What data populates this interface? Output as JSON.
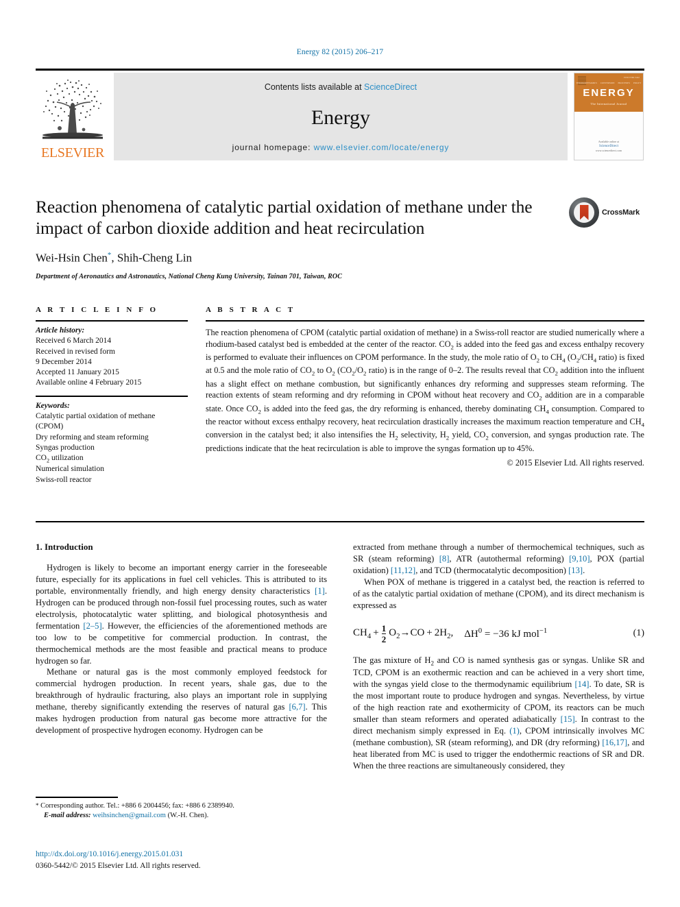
{
  "running_head": "Energy 82 (2015) 206–217",
  "masthead": {
    "publisher_word": "ELSEVIER",
    "contents_prefix": "Contents lists available at ",
    "contents_link": "ScienceDirect",
    "journal_name": "Energy",
    "homepage_prefix": "journal homepage: ",
    "homepage_url": "www.elsevier.com/locate/energy",
    "cover": {
      "title": "ENERGY",
      "subtitle": "The International Journal",
      "corner_label": "ISSN 0360-5442",
      "bottom_line1": "Available online at",
      "bottom_line2": "ScienceDirect",
      "bottom_line3": "www.sciencedirect.com",
      "tags": [
        "THERMODYNAMICS",
        "CONVERSION",
        "PROCESSES",
        "POLICY"
      ],
      "tags2": [
        "ENERGY",
        "ELECTRICITY",
        "RENEWABILITY",
        "FUELS"
      ]
    }
  },
  "article": {
    "title": "Reaction phenomena of catalytic partial oxidation of methane under the impact of carbon dioxide addition and heat recirculation",
    "authors": "Wei-Hsin Chen, Shih-Cheng Lin",
    "author_marker": "*",
    "affiliation": "Department of Aeronautics and Astronautics, National Cheng Kung University, Tainan 701, Taiwan, ROC",
    "crossmark_label": "CrossMark"
  },
  "article_info": {
    "heading": "A R T I C L E   I N F O",
    "history_label": "Article history:",
    "history": [
      "Received 6 March 2014",
      "Received in revised form",
      "9 December 2014",
      "Accepted 11 January 2015",
      "Available online 4 February 2015"
    ],
    "keywords_label": "Keywords:",
    "keywords": [
      "Catalytic partial oxidation of methane",
      "(CPOM)",
      "Dry reforming and steam reforming",
      "Syngas production",
      "CO2 utilization",
      "Numerical simulation",
      "Swiss-roll reactor"
    ]
  },
  "abstract": {
    "heading": "A B S T R A C T",
    "text": "The reaction phenomena of CPOM (catalytic partial oxidation of methane) in a Swiss-roll reactor are studied numerically where a rhodium-based catalyst bed is embedded at the center of the reactor. CO2 is added into the feed gas and excess enthalpy recovery is performed to evaluate their influences on CPOM performance. In the study, the mole ratio of O2 to CH4 (O2/CH4 ratio) is fixed at 0.5 and the mole ratio of CO2 to O2 (CO2/O2 ratio) is in the range of 0–2. The results reveal that CO2 addition into the influent has a slight effect on methane combustion, but significantly enhances dry reforming and suppresses steam reforming. The reaction extents of steam reforming and dry reforming in CPOM without heat recovery and CO2 addition are in a comparable state. Once CO2 is added into the feed gas, the dry reforming is enhanced, thereby dominating CH4 consumption. Compared to the reactor without excess enthalpy recovery, heat recirculation drastically increases the maximum reaction temperature and CH4 conversion in the catalyst bed; it also intensifies the H2 selectivity, H2 yield, CO2 conversion, and syngas production rate. The predictions indicate that the heat recirculation is able to improve the syngas formation up to 45%.",
    "copyright": "© 2015 Elsevier Ltd. All rights reserved."
  },
  "body": {
    "section_number_title": "1. Introduction",
    "left_para_1": "Hydrogen is likely to become an important energy carrier in the foreseeable future, especially for its applications in fuel cell vehicles. This is attributed to its portable, environmentally friendly, and high energy density characteristics [1]. Hydrogen can be produced through non-fossil fuel processing routes, such as water electrolysis, photocatalytic water splitting, and biological photosynthesis and fermentation [2–5]. However, the efficiencies of the aforementioned methods are too low to be competitive for commercial production. In contrast, the thermochemical methods are the most feasible and practical means to produce hydrogen so far.",
    "left_para_2": "Methane or natural gas is the most commonly employed feedstock for commercial hydrogen production. In recent years, shale gas, due to the breakthrough of hydraulic fracturing, also plays an important role in supplying methane, thereby significantly extending the reserves of natural gas [6,7]. This makes hydrogen production from natural gas become more attractive for the development of prospective hydrogen economy. Hydrogen can be",
    "right_para_1": "extracted from methane through a number of thermochemical techniques, such as SR (steam reforming) [8], ATR (autothermal reforming) [9,10], POX (partial oxidation) [11,12], and TCD (thermocatalytic decomposition) [13].",
    "right_para_2": "When POX of methane is triggered in a catalyst bed, the reaction is referred to of as the catalytic partial oxidation of methane (CPOM), and its direct mechanism is expressed as",
    "equation": {
      "left_reactant": "CH4 +",
      "fraction_num": "1",
      "fraction_den": "2",
      "rest": "O2→CO + 2H2,",
      "enthalpy": "ΔH0 = −36 kJ mol−1",
      "number": "(1)"
    },
    "right_para_3": "The gas mixture of H2 and CO is named synthesis gas or syngas. Unlike SR and TCD, CPOM is an exothermic reaction and can be achieved in a very short time, with the syngas yield close to the thermodynamic equilibrium [14]. To date, SR is the most important route to produce hydrogen and syngas. Nevertheless, by virtue of the high reaction rate and exothermicity of CPOM, its reactors can be much smaller than steam reformers and operated adiabatically [15]. In contrast to the direct mechanism simply expressed in Eq. (1), CPOM intrinsically involves MC (methane combustion), SR (steam reforming), and DR (dry reforming) [16,17], and heat liberated from MC is used to trigger the endothermic reactions of SR and DR. When the three reactions are simultaneously considered, they"
  },
  "footnote": {
    "marker": "*",
    "corresponding": "Corresponding author. Tel.: +886 6 2004456; fax: +886 6 2389940.",
    "email_label": "E-mail address:",
    "email": "weihsinchen@gmail.com",
    "email_owner": "(W.-H. Chen)."
  },
  "footer": {
    "doi": "http://dx.doi.org/10.1016/j.energy.2015.01.031",
    "issn_line": "0360-5442/© 2015 Elsevier Ltd. All rights reserved."
  },
  "colors": {
    "link": "#1070a5",
    "sciencedirect": "#2b8ec6",
    "elsevier_orange": "#E87722",
    "banner_gray": "#e5e5e5"
  }
}
